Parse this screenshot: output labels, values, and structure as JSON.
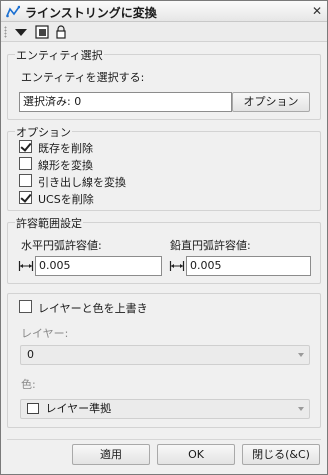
{
  "window": {
    "title": "ラインストリングに変換",
    "close_glyph": "✕"
  },
  "toolbar": {
    "icons": [
      "dropdown-triangle-icon",
      "select-objects-icon",
      "lock-icon"
    ]
  },
  "entity_select": {
    "group_title": "エンティティ選択",
    "prompt": "エンティティを選択する:",
    "selected_count_text": "選択済み: 0",
    "options_button": "オプション"
  },
  "options": {
    "group_title": "オプション",
    "items": [
      {
        "label": "既存を削除",
        "checked": true
      },
      {
        "label": "線形を変換",
        "checked": false
      },
      {
        "label": "引き出し線を変換",
        "checked": false
      },
      {
        "label": "UCSを削除",
        "checked": true
      }
    ]
  },
  "tolerance": {
    "group_title": "許容範囲設定",
    "horizontal_label": "水平円弧許容値:",
    "horizontal_value": "0.005",
    "vertical_label": "鉛直円弧許容値:",
    "vertical_value": "0.005"
  },
  "override": {
    "checkbox_label": "レイヤーと色を上書き",
    "checked": false,
    "layer_label": "レイヤー:",
    "layer_value": "0",
    "color_label": "色:",
    "color_value": "レイヤー準拠",
    "color_swatch": "#ffffff"
  },
  "footer": {
    "apply_button": "適用",
    "ok_button": "OK",
    "close_button": "閉じる(&C)"
  }
}
